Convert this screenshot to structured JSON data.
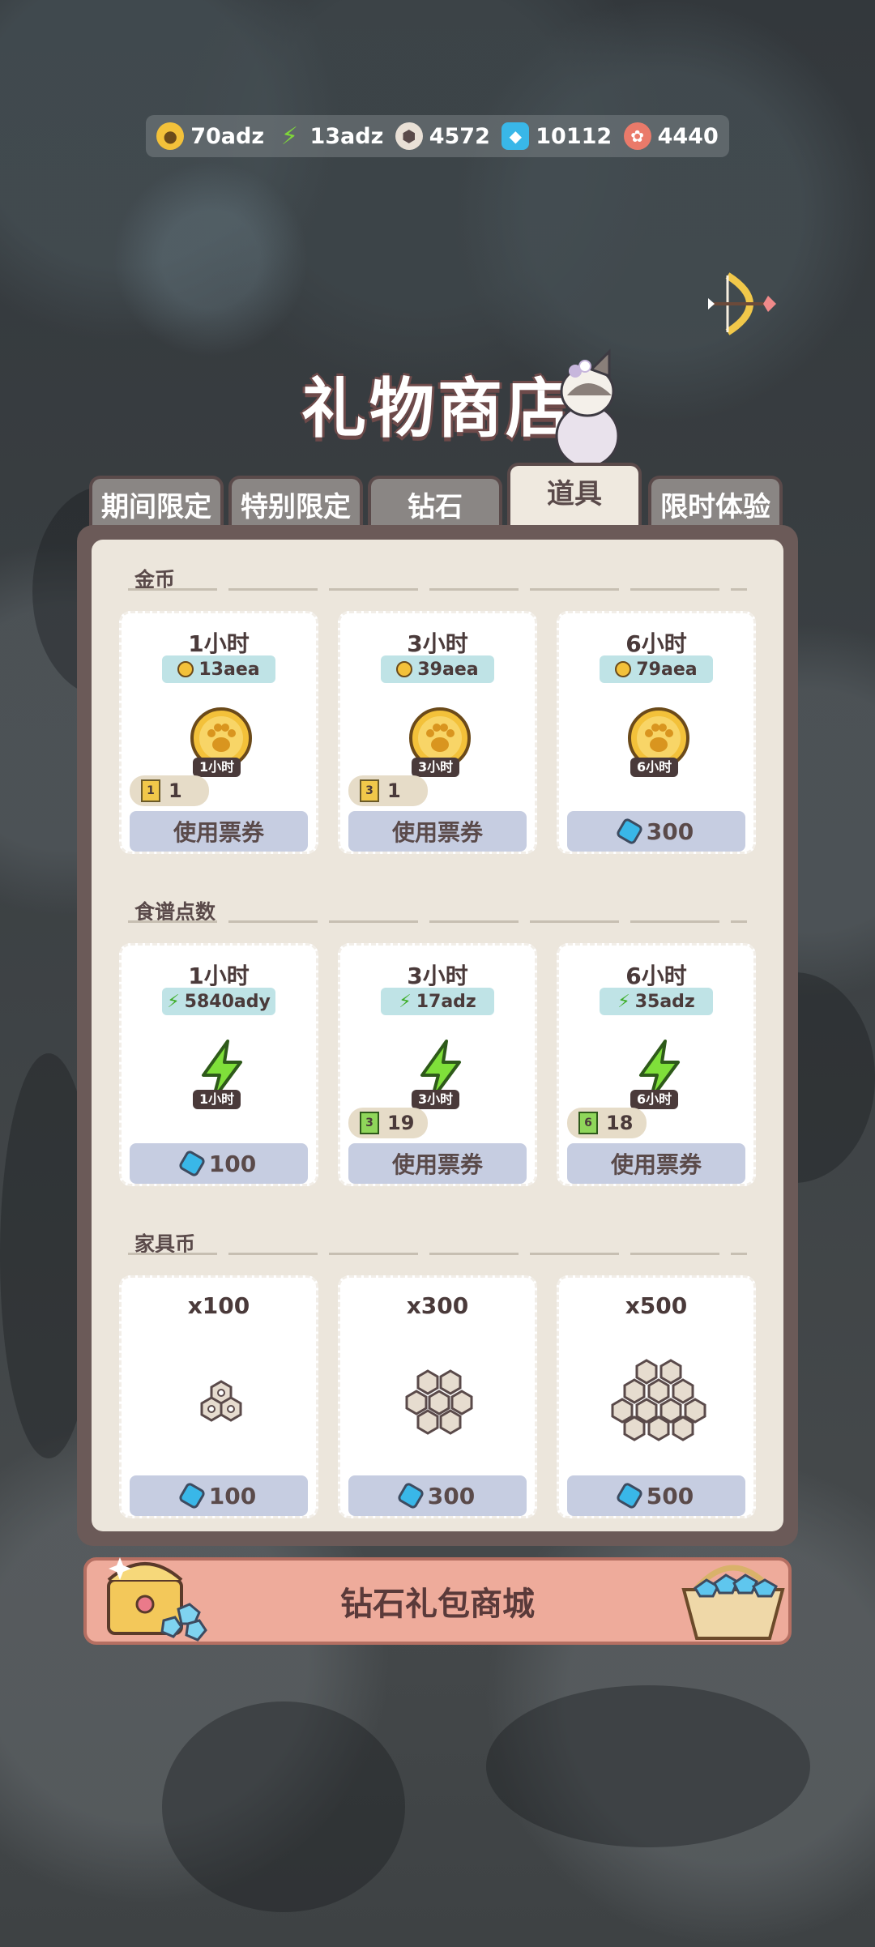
{
  "resources": [
    {
      "icon": "gold-coin-icon",
      "value": "70adz"
    },
    {
      "icon": "lightning-icon",
      "value": "13adz"
    },
    {
      "icon": "furniture-coin-icon",
      "value": "4572"
    },
    {
      "icon": "diamond-icon",
      "value": "10112"
    },
    {
      "icon": "fish-token-icon",
      "value": "4440"
    }
  ],
  "title": "礼物商店",
  "tabs": [
    "期间限定",
    "特别限定",
    "钻石",
    "道具",
    "限时体验"
  ],
  "active_tab": "道具",
  "sections": [
    {
      "label": "金币",
      "cards": [
        {
          "duration": "1小时",
          "yield": "13aea",
          "tag": "1小时",
          "ticket_num": "1",
          "ticket_count": "1",
          "button": "使用票券"
        },
        {
          "duration": "3小时",
          "yield": "39aea",
          "tag": "3小时",
          "ticket_num": "3",
          "ticket_count": "1",
          "button": "使用票券"
        },
        {
          "duration": "6小时",
          "yield": "79aea",
          "tag": "6小时",
          "price": "300"
        }
      ]
    },
    {
      "label": "食谱点数",
      "cards": [
        {
          "duration": "1小时",
          "yield": "5840ady",
          "tag": "1小时",
          "price": "100"
        },
        {
          "duration": "3小时",
          "yield": "17adz",
          "tag": "3小时",
          "ticket_num": "3",
          "ticket_count": "19",
          "button": "使用票券"
        },
        {
          "duration": "6小时",
          "yield": "35adz",
          "tag": "6小时",
          "ticket_num": "6",
          "ticket_count": "18",
          "button": "使用票券"
        }
      ]
    },
    {
      "label": "家具币",
      "cards": [
        {
          "amount": "x100",
          "price": "100"
        },
        {
          "amount": "x300",
          "price": "300"
        },
        {
          "amount": "x500",
          "price": "500"
        }
      ]
    }
  ],
  "banner": "钻石礼包商城",
  "colors": {
    "panel_border": "#6b5a58",
    "panel_bg": "#ece6dc",
    "button_bg": "#c6cde1",
    "pill_bg": "#bfe3e6",
    "banner_bg": "#eeab9b"
  }
}
